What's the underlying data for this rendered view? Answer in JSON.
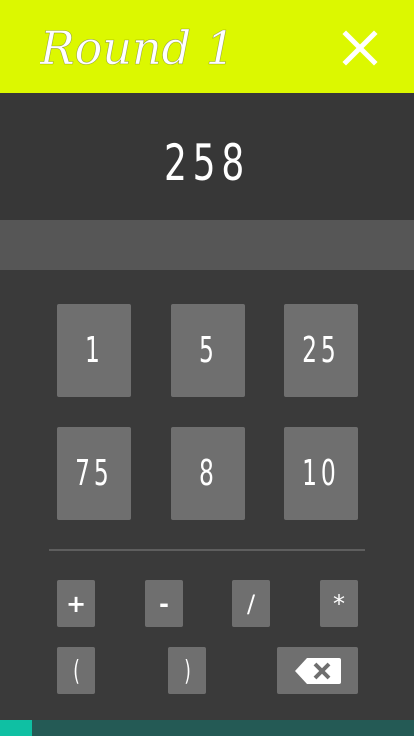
{
  "header": {
    "title": "Round 1",
    "close_icon": "close-icon"
  },
  "target": {
    "value": "258"
  },
  "expression": {
    "value": ""
  },
  "numbers": [
    "1",
    "5",
    "25",
    "75",
    "8",
    "10"
  ],
  "operators": {
    "plus": "+",
    "minus": "-",
    "divide": "/",
    "multiply": "*",
    "open_paren": "(",
    "close_paren": ")",
    "backspace_icon": "backspace-icon"
  },
  "progress": {
    "fraction": 0.077
  },
  "colors": {
    "header_bg": "#dcf800",
    "body_bg": "#3a3a3a",
    "tile_bg": "#6f6f6f",
    "progress_fill": "#0fc0a3",
    "progress_track": "#245a55"
  }
}
